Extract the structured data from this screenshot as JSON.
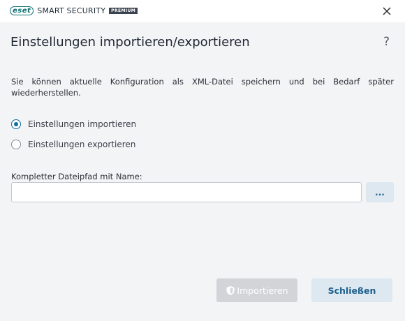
{
  "titlebar": {
    "brand": "eset",
    "product": "SMART SECURITY",
    "edition": "PREMIUM"
  },
  "header": {
    "title": "Einstellungen importieren/exportieren",
    "help": "?"
  },
  "description": "Sie können aktuelle Konfiguration als XML-Datei speichern und bei Bedarf später wiederherstellen.",
  "options": {
    "import_label": "Einstellungen importieren",
    "import_selected": true,
    "export_label": "Einstellungen exportieren",
    "export_selected": false
  },
  "path": {
    "label": "Kompletter Dateipfad mit Name:",
    "value": "",
    "browse_label": "..."
  },
  "footer": {
    "import_button": "Importieren",
    "import_enabled": false,
    "close_button": "Schließen"
  },
  "colors": {
    "brand": "#0b6e72",
    "accent": "#0e6f9e",
    "button_bg": "#dde8f1",
    "button_text": "#1c5f8c",
    "disabled_bg": "#d2d4d7"
  },
  "icons": {
    "close": "close-icon",
    "help": "help-icon",
    "shield": "shield-icon"
  }
}
